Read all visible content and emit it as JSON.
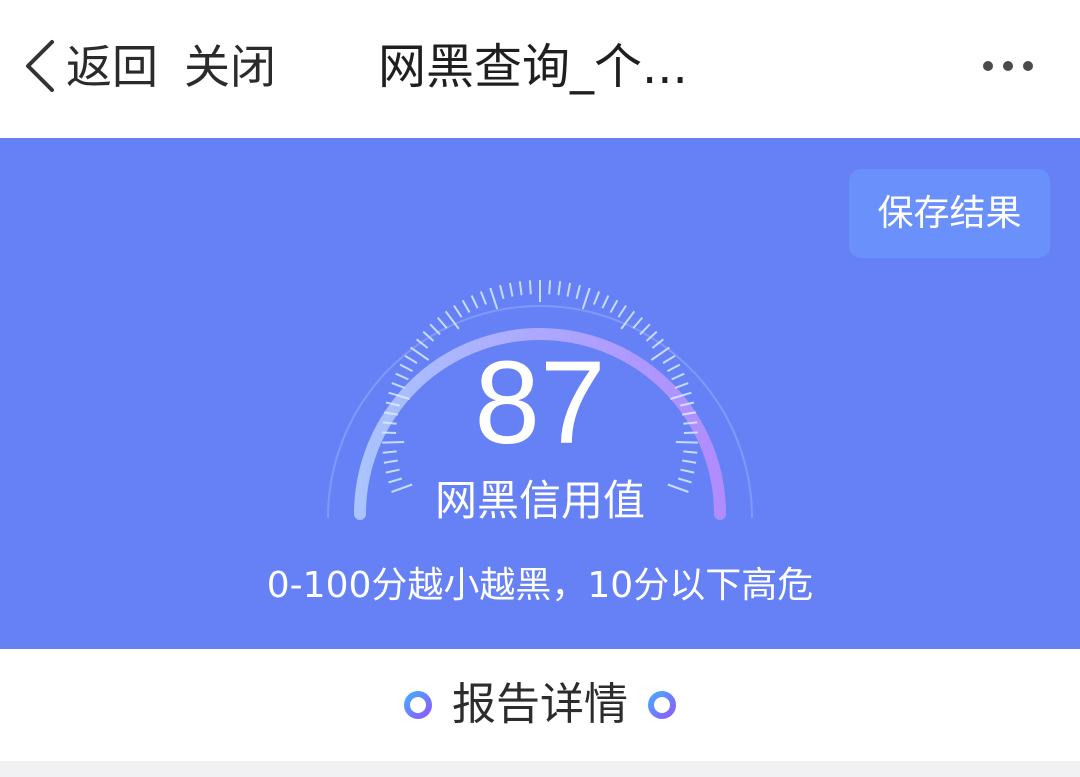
{
  "header": {
    "back_label": "返回",
    "close_label": "关闭",
    "title": "网黑查询_个..."
  },
  "hero": {
    "save_label": "保存结果",
    "score": "87",
    "score_label": "网黑信用值",
    "hint": "0-100分越小越黑，10分以下高危",
    "score_fraction": 0.87
  },
  "report": {
    "title": "报告详情"
  },
  "icons": {
    "back": "chevron-left-icon",
    "more": "more-horizontal-icon",
    "report_dot": "ring-dot-icon"
  },
  "colors": {
    "hero_bg": "#6680f6",
    "save_bg": "#6a90fc",
    "gauge_start": "#a9c4ff",
    "gauge_end": "#b08cff",
    "tick": "#d9ecff"
  }
}
